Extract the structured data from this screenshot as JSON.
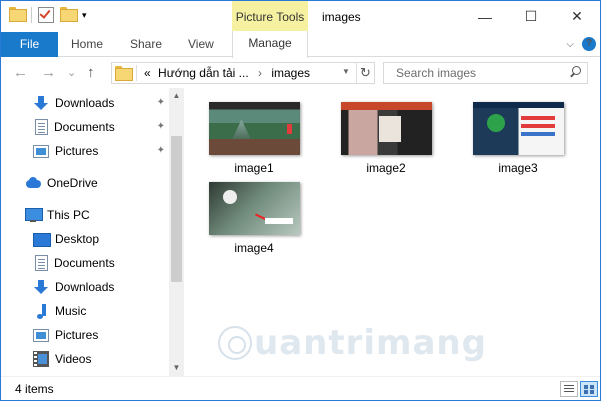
{
  "window": {
    "title": "images",
    "context_tab": "Picture Tools",
    "controls": {
      "minimize": "—",
      "maximize": "☐",
      "close": "✕"
    }
  },
  "ribbon": {
    "file": "File",
    "tabs": [
      "Home",
      "Share",
      "View"
    ],
    "manage": "Manage",
    "collapse": "⌵",
    "help": "?"
  },
  "address": {
    "prefix": "«",
    "crumbs": [
      "Hướng dẫn tải ...",
      "images"
    ],
    "separator": "›",
    "dropdown": "▼",
    "refresh": "↻"
  },
  "nav": {
    "back": "←",
    "forward": "→",
    "dropdown": "⌄",
    "up": "↑"
  },
  "search": {
    "placeholder": "Search images"
  },
  "sidebar": {
    "items": [
      {
        "label": "Downloads",
        "icon": "download-icon",
        "pinned": true
      },
      {
        "label": "Documents",
        "icon": "documents-icon",
        "pinned": true
      },
      {
        "label": "Pictures",
        "icon": "pictures-icon",
        "pinned": true
      },
      {
        "label": "OneDrive",
        "icon": "onedrive-icon",
        "pinned": false
      },
      {
        "label": "This PC",
        "icon": "this-pc-icon",
        "pinned": false
      },
      {
        "label": "Desktop",
        "icon": "desktop-icon",
        "pinned": false
      },
      {
        "label": "Documents",
        "icon": "documents-icon",
        "pinned": false
      },
      {
        "label": "Downloads",
        "icon": "download-icon",
        "pinned": false
      },
      {
        "label": "Music",
        "icon": "music-icon",
        "pinned": false
      },
      {
        "label": "Pictures",
        "icon": "pictures-icon",
        "pinned": false
      },
      {
        "label": "Videos",
        "icon": "videos-icon",
        "pinned": false
      }
    ],
    "pin_glyph": "📌",
    "scroll_up": "▲",
    "scroll_down": "▼"
  },
  "files": [
    {
      "name": "image1"
    },
    {
      "name": "image2"
    },
    {
      "name": "image3"
    },
    {
      "name": "image4"
    }
  ],
  "watermark": {
    "text": "uantrimang"
  },
  "status": {
    "count": "4 items"
  },
  "colors": {
    "accent": "#1979ca",
    "context_tab": "#f6f1a1",
    "border": "#2b79d6"
  }
}
